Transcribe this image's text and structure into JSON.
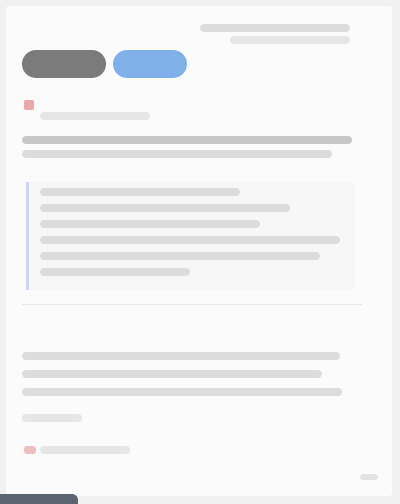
{
  "toolbar": {
    "primary_label": "",
    "secondary_label": ""
  },
  "colors": {
    "background": "#f1f1f1",
    "card": "#fbfbfb",
    "dark_button": "#7b7b7b",
    "accent_button": "#7fb0e8",
    "flag": "#eaa8a8",
    "quote_border": "#c9d8f0",
    "bottom_tab": "#5b6470"
  },
  "icons": {
    "flag": "flag-icon",
    "small_marker": "marker-icon"
  }
}
